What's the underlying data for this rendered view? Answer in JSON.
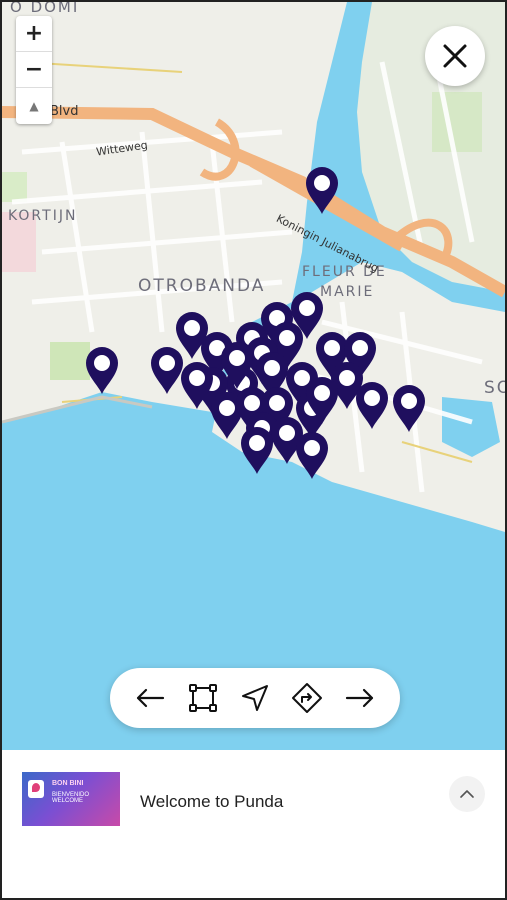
{
  "map": {
    "place_labels": {
      "kortijn": "KORTIJN",
      "otrobanda": "OTROBANDA",
      "fleur_line1": "FLEUR DE",
      "fleur_line2": "MARIE",
      "so": "SO",
      "top_partial": "O DOMI"
    },
    "road_labels": {
      "witteweg": "Witteweg",
      "blvd": "Blvd",
      "bridge": "Koningin Julianabrug"
    },
    "controls": {
      "zoom_in": "+",
      "zoom_out": "−",
      "compass": "▲"
    },
    "marker_color": "#1f0f5e",
    "water_color": "#7fd0ef",
    "land_color": "#efefe9"
  },
  "close_icon": "close-icon",
  "toolbar": {
    "items": [
      "arrow-left-icon",
      "bounding-box-icon",
      "navigation-icon",
      "directions-icon",
      "arrow-right-icon"
    ]
  },
  "panel": {
    "title": "Welcome to Punda",
    "thumbnail": {
      "headline": "BON BINI",
      "subline": "BIENVENIDO WELCOME"
    },
    "expand_icon": "chevron-up-icon"
  }
}
